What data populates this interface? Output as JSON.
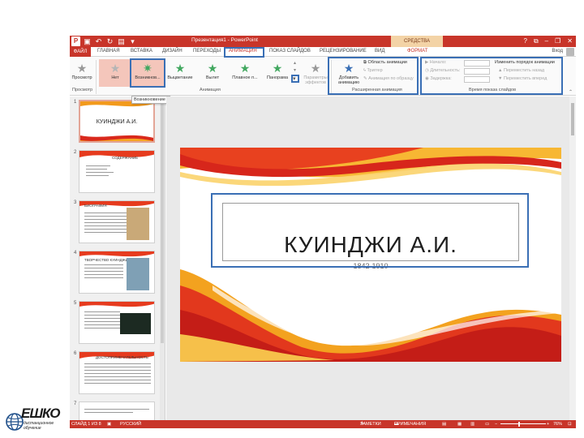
{
  "app": {
    "window_title": "Презентация1 - PowerPoint",
    "drawing_tools_tab": "СРЕДСТВА РИСОВАНИЯ",
    "sign_in": "Вход",
    "window_buttons": [
      "?",
      "⧉",
      "–",
      "❐",
      "✕"
    ]
  },
  "tabs": [
    {
      "label": "ФАЙЛ"
    },
    {
      "label": "ГЛАВНАЯ"
    },
    {
      "label": "ВСТАВКА"
    },
    {
      "label": "ДИЗАЙН"
    },
    {
      "label": "ПЕРЕХОДЫ"
    },
    {
      "label": "АНИМАЦИЯ"
    },
    {
      "label": "ПОКАЗ СЛАЙДОВ"
    },
    {
      "label": "РЕЦЕНЗИРОВАНИЕ"
    },
    {
      "label": "ВИД"
    },
    {
      "label": "ФОРМАТ"
    }
  ],
  "ribbon": {
    "preview": {
      "label": "Просмотр",
      "group": "Просмотр"
    },
    "animations": [
      {
        "label": "Нет"
      },
      {
        "label": "Возникнов..."
      },
      {
        "label": "Выцветание"
      },
      {
        "label": "Вылет"
      },
      {
        "label": "Плавное п..."
      },
      {
        "label": "Панорама"
      }
    ],
    "effect_params_1": "Параметры",
    "effect_params_2": "эффектов",
    "animation_group": "Анимация",
    "add_animation_1": "Добавить",
    "add_animation_2": "анимацию",
    "animation_pane": "Область анимации",
    "trigger": "Триггер",
    "animation_painter": "Анимация по образцу",
    "advanced_group": "Расширенная анимация",
    "start": "Начало:",
    "duration": "Длительность:",
    "delay": "Задержка:",
    "reorder": "Изменить порядок анимации",
    "move_earlier": "Переместить назад",
    "move_later": "Переместить вперед",
    "timing_group": "Время показа слайдов",
    "tooltip": "Возникновение"
  },
  "slides": [
    {
      "num": "1",
      "title": "КУИНДЖИ А.И."
    },
    {
      "num": "2",
      "title": "СОДЕРЖАНИЕ"
    },
    {
      "num": "3",
      "title": "БИОГРАФИЯ"
    },
    {
      "num": "4",
      "title": "ТВОРЧЕСТВО КУИНДЖИ"
    },
    {
      "num": "5",
      "title": ""
    },
    {
      "num": "6",
      "title": "ДОСТОПРИМЕЧАТЕЛЬНОСТЬ"
    },
    {
      "num": "7",
      "title": ""
    }
  ],
  "slide": {
    "title": "КУИНДЖИ А.И.",
    "subtitle": "1842-1910"
  },
  "status": {
    "slide_info": "СЛАЙД 1 ИЗ 8",
    "language": "РУССКИЙ",
    "notes": "ЗАМЕТКИ",
    "comments": "ПРИМЕЧАНИЯ",
    "zoom": "76%"
  },
  "logo": {
    "text": "ЕШКО",
    "sub": "дистанционное обучение"
  },
  "colors": {
    "accent": "#c8352a",
    "highlight": "#3a6fb5",
    "animation_star": "#42a860"
  }
}
